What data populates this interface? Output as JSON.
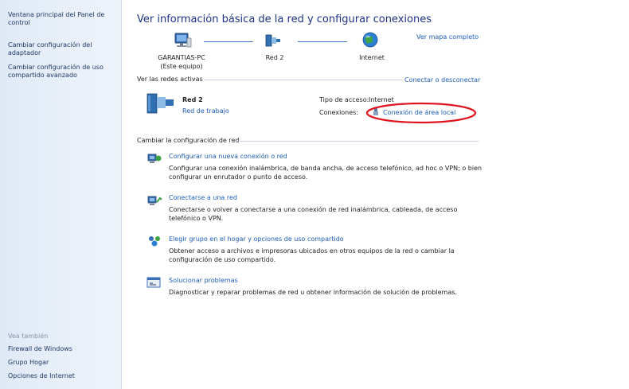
{
  "left_pane": {
    "links": [
      "Ventana principal del Panel de control",
      "Cambiar configuración del adaptador",
      "Cambiar configuración de uso compartido avanzado"
    ],
    "see_also_heading": "Vea también",
    "see_also": [
      "Firewall de Windows",
      "Grupo Hogar",
      "Opciones de Internet"
    ]
  },
  "main": {
    "title": "Ver información básica de la red y configurar conexiones",
    "full_map_link": "Ver mapa completo",
    "map": {
      "computer_name": "GARANTIAS-PC",
      "computer_sub": "(Este equipo)",
      "network_name": "Red 2",
      "internet_label": "Internet"
    },
    "active_networks": {
      "heading": "Ver las redes activas",
      "connect_link": "Conectar o desconectar",
      "network_name": "Red 2",
      "network_type": "Red de trabajo",
      "access_type_label": "Tipo de acceso:",
      "access_type_value": "Internet",
      "connections_label": "Conexiones:",
      "connection_value": "Conexión de área local",
      "highlight_color": "#e0141e"
    },
    "change_settings": {
      "heading": "Cambiar la configuración de red",
      "tasks": [
        {
          "title": "Configurar una nueva conexión o red",
          "desc": "Configurar una conexión inalámbrica, de banda ancha, de acceso telefónico, ad hoc o VPN; o bien configurar un enrutador o punto de acceso.",
          "icon": "network-setup-icon"
        },
        {
          "title": "Conectarse a una red",
          "desc": "Conectarse o volver a conectarse a una conexión de red inalámbrica, cableada, de acceso telefónico o VPN.",
          "icon": "network-connect-icon"
        },
        {
          "title": "Elegir grupo en el hogar y opciones de uso compartido",
          "desc": "Obtener acceso a archivos e impresoras ubicados en otros equipos de la red o cambiar la configuración de uso compartido.",
          "icon": "homegroup-icon"
        },
        {
          "title": "Solucionar problemas",
          "desc": "Diagnosticar y reparar problemas de red u obtener información de solución de problemas.",
          "icon": "troubleshoot-icon"
        }
      ]
    }
  }
}
